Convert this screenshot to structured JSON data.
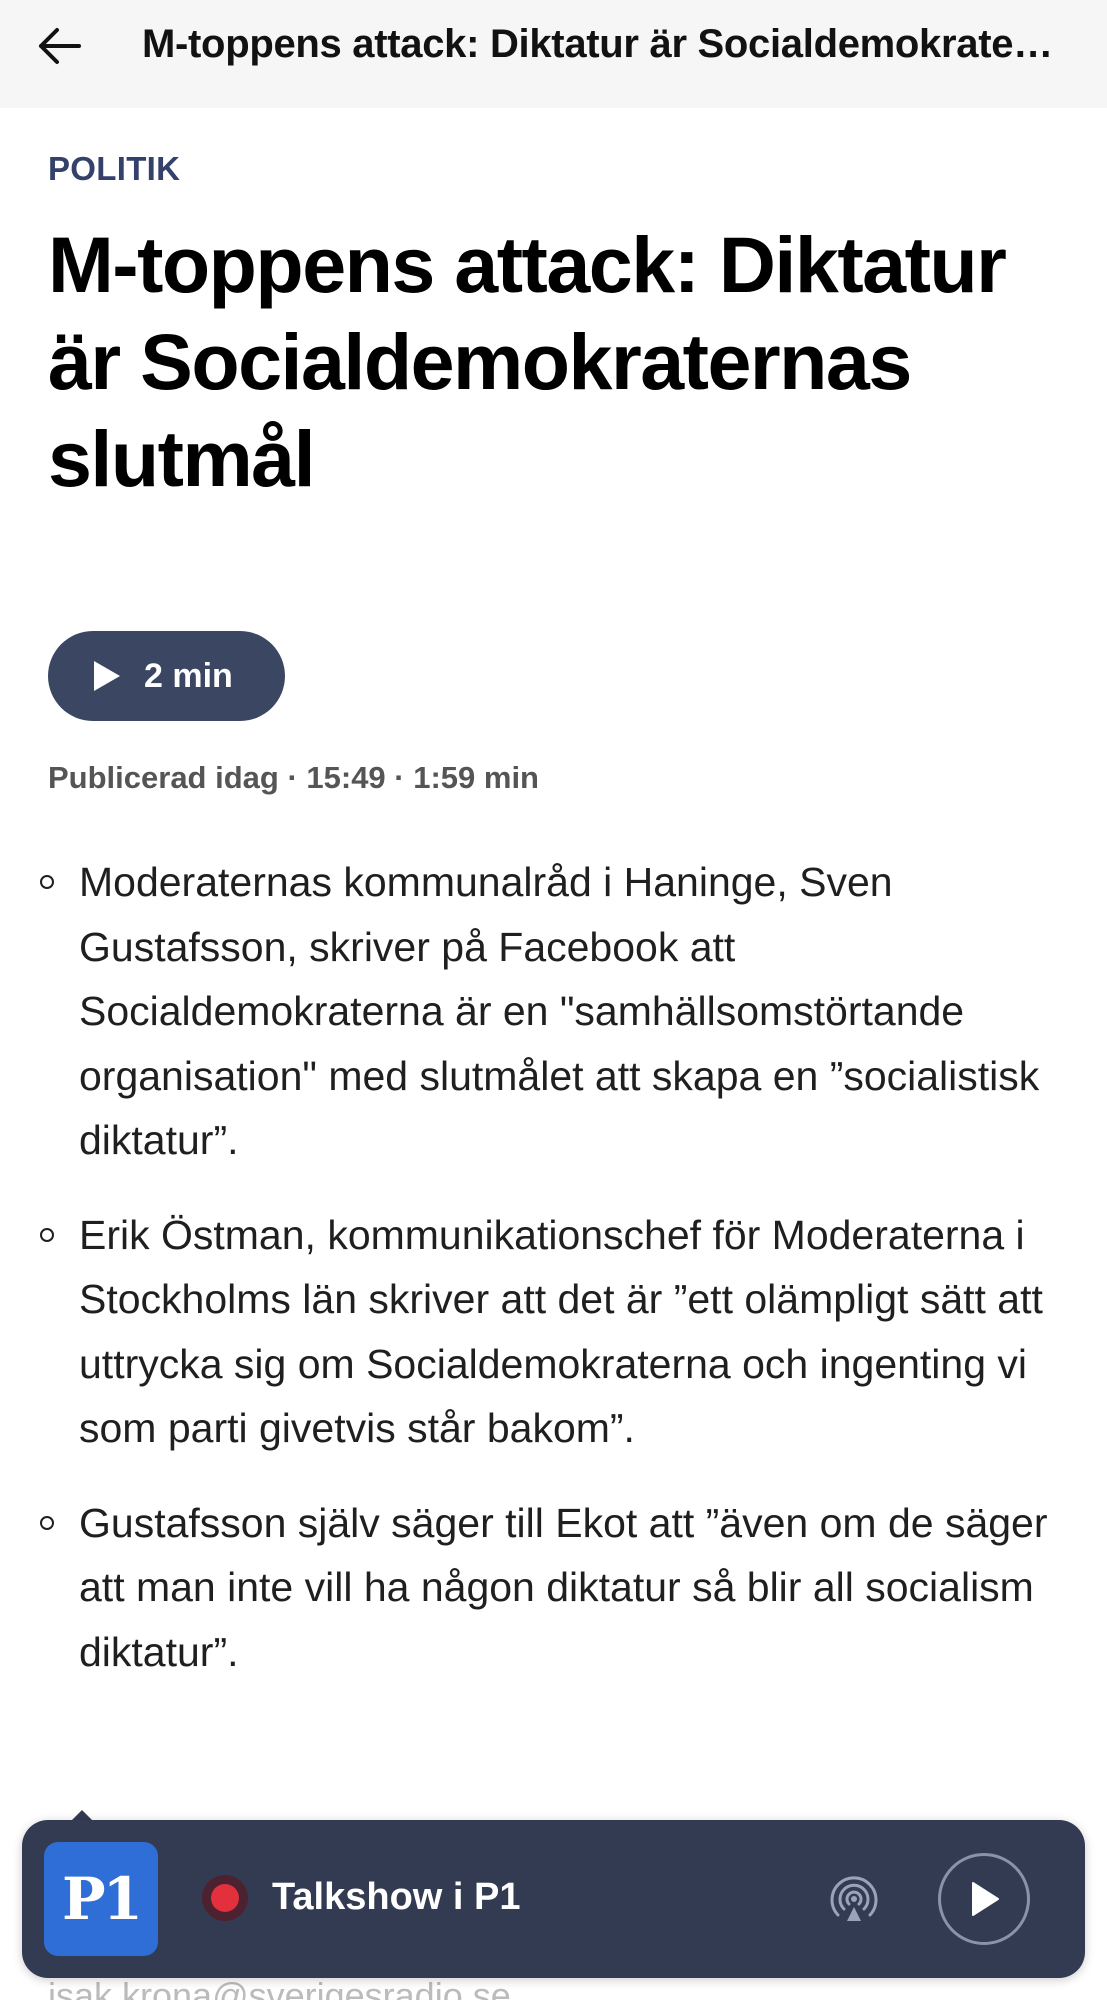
{
  "header": {
    "back_icon": "arrow-left-icon",
    "title": "M-toppens attack: Diktatur är Socialdemokraternas slutmål"
  },
  "article": {
    "category": "POLITIK",
    "headline": "M-toppens attack: Diktatur är Socialdemokraternas slutmål",
    "listen": {
      "icon": "play-icon",
      "label": "2 min"
    },
    "meta": "Publicerad idag · 15:49 · 1:59 min",
    "bullets": [
      "Moderaternas kommunalråd i Haninge, Sven Gustafsson, skriver på Facebook att Socialdemokraterna är en \"samhällsomstörtande organisation\" med slutmålet att skapa en ”socialistisk diktatur”.",
      "Erik Östman, kommunikationschef för Moderaterna i Stockholms län skriver att det är ”ett olämpligt sätt att uttrycka sig om Socialdemokraterna och ingenting vi som parti givetvis står bakom”.",
      "Gustafsson själv säger till Ekot att ”även om de säger att man inte vill ha någon diktatur så blir all socialism diktatur”."
    ],
    "partial_footer_text": "isak.krona@sverigesradio.se"
  },
  "player": {
    "channel_logo": "P1",
    "live_indicator_color": "#e3303d",
    "title": "Talkshow i P1",
    "cast_icon": "broadcast-icon",
    "play_icon": "play-icon"
  },
  "colors": {
    "accent": "#34416b",
    "player_background": "#333b52",
    "listen_button": "#3a4662",
    "channel_logo_bg": "#2e6ed6"
  }
}
